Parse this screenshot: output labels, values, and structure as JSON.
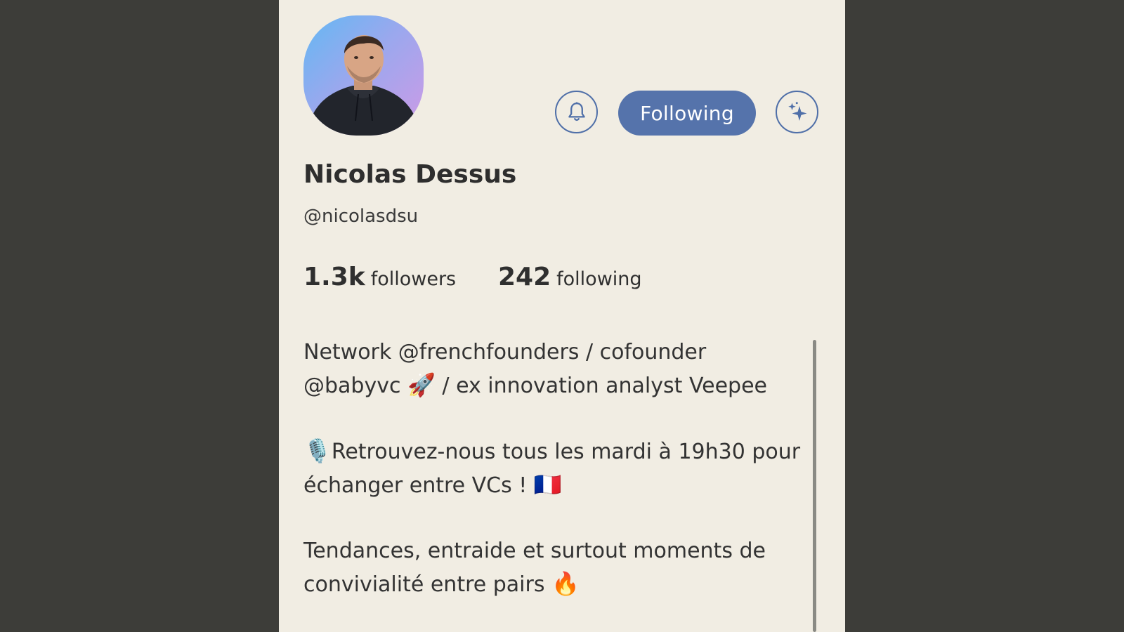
{
  "profile": {
    "name": "Nicolas Dessus",
    "handle": "@nicolasdsu",
    "follow_label": "Following",
    "stats": {
      "followers_count": "1.3k",
      "followers_label": "followers",
      "following_count": "242",
      "following_label": "following"
    },
    "bio": {
      "line1": "Network @frenchfounders / cofounder",
      "line2_a": "@babyvc",
      "line2_emoji": "🚀",
      "line2_b": "/ ex innovation analyst Veepee",
      "line3_emoji": "🎙️",
      "line3": "Retrouvez-nous tous les mardi à 19h30 pour",
      "line4": "échanger entre VCs !",
      "line4_emoji": "🇫🇷",
      "line5": "Tendances, entraide et surtout moments de",
      "line6": "convivialité entre pairs",
      "line6_emoji": "🔥"
    }
  },
  "icons": {
    "notify": "bell-icon",
    "special": "sparkles-icon"
  },
  "colors": {
    "accent": "#5573ab",
    "panel_bg": "#f1ede3",
    "backdrop": "#3d3d39"
  }
}
